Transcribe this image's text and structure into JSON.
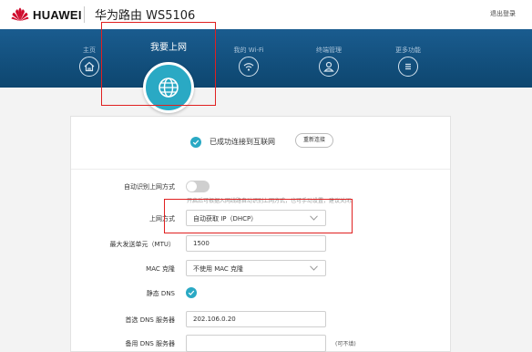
{
  "header": {
    "brand": "HUAWEI",
    "router_title": "华为路由 WS5106",
    "logout": "退出登录",
    "brand_color": "#cf0a2c"
  },
  "nav": {
    "items": [
      {
        "label": "主页",
        "icon": "home-icon"
      },
      {
        "label": "我要上网",
        "icon": "globe-icon",
        "active": true
      },
      {
        "label": "我的 Wi-Fi",
        "icon": "wifi-icon"
      },
      {
        "label": "终端管理",
        "icon": "user-icon"
      },
      {
        "label": "更多功能",
        "icon": "menu-icon"
      }
    ],
    "band_color": "#0d466f",
    "accent": "#2aa9c4"
  },
  "status": {
    "text": "已成功连接到互联网",
    "reconnect_label": "重新连接"
  },
  "form": {
    "auto_detect_label": "自动识别上网方式",
    "auto_detect_enabled": false,
    "auto_detect_hint": "开启后可根据入网线路自动识别上网方式，也可手动设置，建议关闭。",
    "mode_label": "上网方式",
    "mode_value": "自动获取 IP（DHCP）",
    "mtu_label": "最大发送单元（MTU）",
    "mtu_value": "1500",
    "mac_label": "MAC 克隆",
    "mac_value": "不使用 MAC 克隆",
    "static_dns_label": "静态 DNS",
    "static_dns_enabled": true,
    "dns1_label": "首选 DNS 服务器",
    "dns1_value": "202.106.0.20",
    "dns2_label": "备用 DNS 服务器",
    "dns2_value": "",
    "dns2_optional": "(可不填)"
  }
}
